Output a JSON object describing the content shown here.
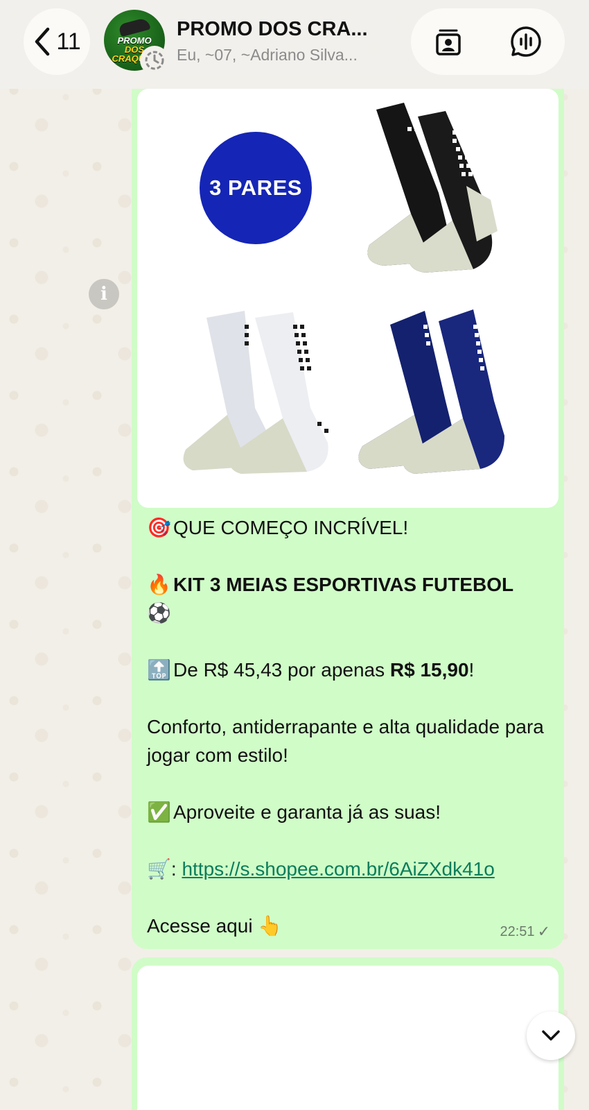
{
  "header": {
    "back_count": "11",
    "group_name": "PROMO DOS CRA...",
    "group_members": "Eu, ~07, ~Adriano Silva...",
    "avatar_text_line1": "PROMO",
    "avatar_text_line2": "DOS CRAQUES"
  },
  "message": {
    "image_badge": "3 PARES",
    "headline_emoji": "🎯",
    "headline": "QUE COMEÇO INCRÍVEL!",
    "title_emoji": "🔥",
    "title": "KIT 3 MEIAS ESPORTIVAS FUTEBOL",
    "title_emoji_after": "⚽",
    "price_emoji": "🔝",
    "price_prefix": "De R$ 45,43 por apenas ",
    "price_value": "R$ 15,90",
    "price_suffix": "!",
    "description": "Conforto, antiderrapante e alta qualidade para jogar com estilo!",
    "cta_emoji": "✅",
    "cta": "Aproveite e garanta já as suas!",
    "link_emoji": "🛒",
    "link_prefix": ": ",
    "link": "https://s.shopee.com.br/6AiZXdk41o",
    "access_text": "Acesse aqui",
    "access_emoji": "👆",
    "time": "22:51",
    "status_tick": "✓"
  },
  "colors": {
    "bubble": "#d0fcc8",
    "link": "#0a7d5a",
    "badge": "#1525b5",
    "header": "#f2f0eb"
  },
  "icons": {
    "back": "chevron-left-icon",
    "status": "status-ring-icon",
    "contact_card": "contact-card-icon",
    "voice_chat": "voice-waveform-icon",
    "info": "info-icon",
    "scroll": "chevron-down-icon"
  }
}
